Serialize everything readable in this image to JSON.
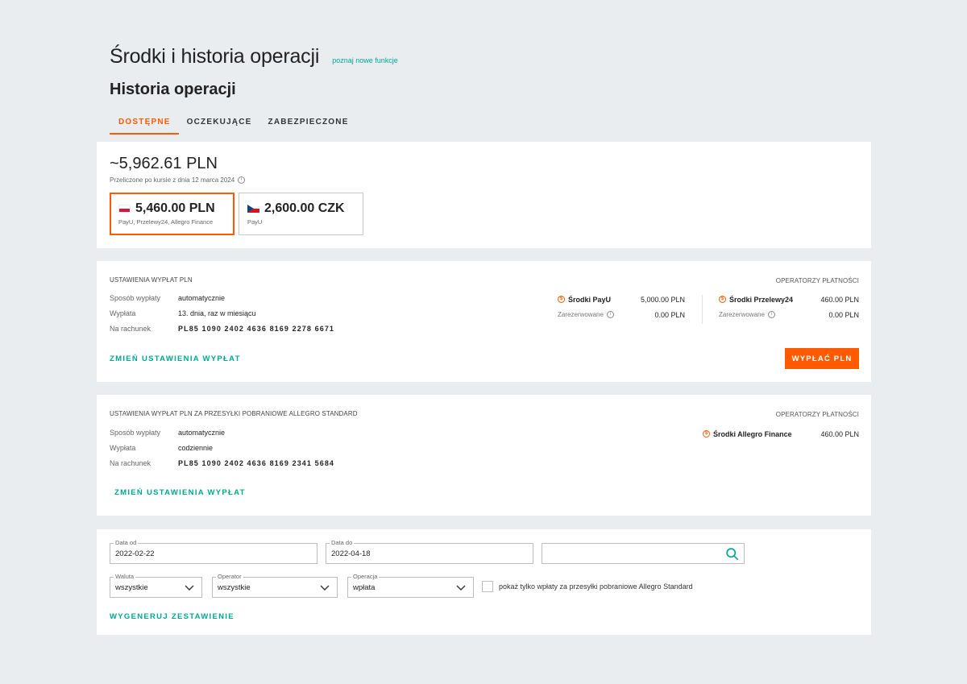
{
  "header": {
    "title": "Środki i historia operacji",
    "new_features_link": "poznaj nowe funkcje",
    "section_title": "Historia operacji"
  },
  "tabs": [
    {
      "label": "DOSTĘPNE",
      "active": true
    },
    {
      "label": "OCZEKUJĄCE",
      "active": false
    },
    {
      "label": "ZABEZPIECZONE",
      "active": false
    }
  ],
  "balance": {
    "total": "~5,962.61 PLN",
    "rate_note": "Przeliczone po kursie z dnia 12 marca 2024",
    "currencies": [
      {
        "amount": "5,460.00 PLN",
        "operators": "PayU, Przelewy24, Allegro Finance",
        "flag": "flag-pl-icon",
        "active": true
      },
      {
        "amount": "2,600.00 CZK",
        "operators": "PayU",
        "flag": "flag-cz-icon",
        "active": false
      }
    ]
  },
  "payout_settings": {
    "heading": "USTAWIENIA WYPŁAT PLN",
    "rows": [
      {
        "label": "Sposób wypłaty",
        "value": "automatycznie"
      },
      {
        "label": "Wypłata",
        "value": "13. dnia, raz w miesiącu"
      },
      {
        "label": "Na rachunek",
        "value": "PL85 1090 2402 4636 8169 2278 6671"
      }
    ],
    "change_link": "ZMIEŃ USTAWIENIA WYPŁAT",
    "operators_heading": "OPERATORZY PŁATNOŚCI",
    "operators": [
      {
        "name": "Środki PayU",
        "value": "5,000.00 PLN",
        "reserved_label": "Zarezerwowane",
        "reserved_value": "0.00 PLN"
      },
      {
        "name": "Środki Przelewy24",
        "value": "460.00 PLN",
        "reserved_label": "Zarezerwowane",
        "reserved_value": "0.00 PLN"
      }
    ],
    "payout_button": "WYPŁAĆ PLN"
  },
  "payout_settings_standard": {
    "heading": "USTAWIENIA WYPŁAT PLN ZA PRZESYŁKI POBRANIOWE ALLEGRO STANDARD",
    "rows": [
      {
        "label": "Sposób wypłaty",
        "value": "automatycznie"
      },
      {
        "label": "Wypłata",
        "value": "codziennie"
      },
      {
        "label": "Na rachunek",
        "value": "PL85 1090 2402 4636 8169 2341 5684"
      }
    ],
    "change_link": "ZMIEŃ USTAWIENIA WYPŁAT",
    "operators_heading": "OPERATORZY PŁATNOŚCI",
    "operators": [
      {
        "name": "Środki Allegro Finance",
        "value": "460.00 PLN"
      }
    ]
  },
  "filters": {
    "date_from": {
      "label": "Data od",
      "value": "2022-02-22"
    },
    "date_to": {
      "label": "Data do",
      "value": "2022-04-18"
    },
    "search": {
      "value": ""
    },
    "currency": {
      "label": "Waluta",
      "value": "wszystkie"
    },
    "operator": {
      "label": "Operator",
      "value": "wszystkie"
    },
    "operation": {
      "label": "Operacja",
      "value": "wpłata"
    },
    "checkbox_label": "pokaż tylko wpłaty za przesyłki pobraniowe Allegro Standard",
    "generate_link": "WYGENERUJ ZESTAWIENIE"
  },
  "colors": {
    "accent": "#ff5a00",
    "link": "#00a790",
    "background": "#eaedf0"
  }
}
